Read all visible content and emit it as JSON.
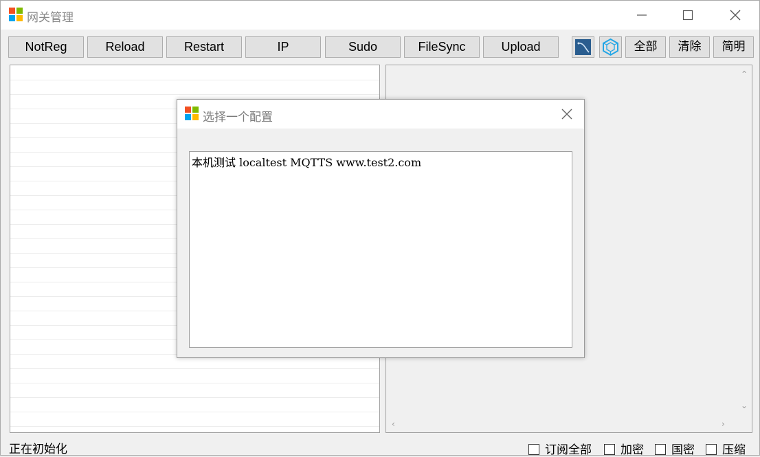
{
  "window": {
    "title": "网关管理",
    "controls": [
      "minimize-icon",
      "maximize-icon",
      "close-icon"
    ]
  },
  "toolbar": {
    "buttons": [
      "NotReg",
      "Reload",
      "Restart",
      "IP",
      "Sudo",
      "FileSync",
      "Upload"
    ],
    "icon_buttons": [
      "chart-icon",
      "hexagon-icon"
    ],
    "right_buttons": [
      "全部",
      "清除",
      "简明"
    ]
  },
  "status": {
    "text": "正在初始化",
    "checkboxes": [
      {
        "label": "订阅全部",
        "checked": false
      },
      {
        "label": "加密",
        "checked": false
      },
      {
        "label": "国密",
        "checked": false
      },
      {
        "label": "压缩",
        "checked": false
      }
    ]
  },
  "dialog": {
    "title": "选择一个配置",
    "items": [
      "本机测试 localtest MQTTS www.test2.com"
    ]
  },
  "colors": {
    "logo_red": "#f25022",
    "logo_green": "#7fba00",
    "logo_blue": "#00a4ef",
    "logo_yellow": "#ffb900",
    "icon_blue": "#2f6fa8"
  }
}
